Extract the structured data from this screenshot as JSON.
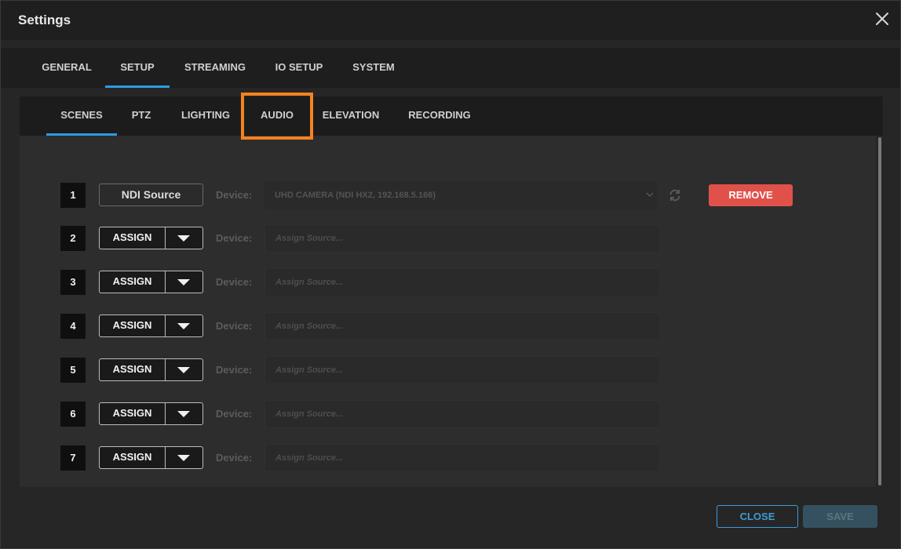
{
  "dialog": {
    "title": "Settings"
  },
  "top_tabs": [
    {
      "label": "GENERAL",
      "active": false
    },
    {
      "label": "SETUP",
      "active": true
    },
    {
      "label": "STREAMING",
      "active": false
    },
    {
      "label": "IO SETUP",
      "active": false
    },
    {
      "label": "SYSTEM",
      "active": false
    }
  ],
  "sub_tabs": [
    {
      "label": "SCENES",
      "active": true
    },
    {
      "label": "PTZ",
      "active": false
    },
    {
      "label": "LIGHTING",
      "active": false
    },
    {
      "label": "AUDIO",
      "active": false,
      "highlighted": true
    },
    {
      "label": "ELEVATION",
      "active": false
    },
    {
      "label": "RECORDING",
      "active": false
    }
  ],
  "scenes": [
    {
      "number": "1",
      "source_button": "NDI Source",
      "device_label": "Device:",
      "device_value": "UHD CAMERA (NDI HX2, 192.168.5.166)",
      "remove_label": "REMOVE"
    },
    {
      "number": "2",
      "assign_label": "ASSIGN",
      "device_label": "Device:",
      "placeholder": "Assign Source..."
    },
    {
      "number": "3",
      "assign_label": "ASSIGN",
      "device_label": "Device:",
      "placeholder": "Assign Source..."
    },
    {
      "number": "4",
      "assign_label": "ASSIGN",
      "device_label": "Device:",
      "placeholder": "Assign Source..."
    },
    {
      "number": "5",
      "assign_label": "ASSIGN",
      "device_label": "Device:",
      "placeholder": "Assign Source..."
    },
    {
      "number": "6",
      "assign_label": "ASSIGN",
      "device_label": "Device:",
      "placeholder": "Assign Source..."
    },
    {
      "number": "7",
      "assign_label": "ASSIGN",
      "device_label": "Device:",
      "placeholder": "Assign Source..."
    }
  ],
  "footer": {
    "close_label": "CLOSE",
    "save_label": "SAVE"
  },
  "colors": {
    "accent": "#2f9be0",
    "highlight": "#f58220",
    "remove": "#e0514a"
  }
}
